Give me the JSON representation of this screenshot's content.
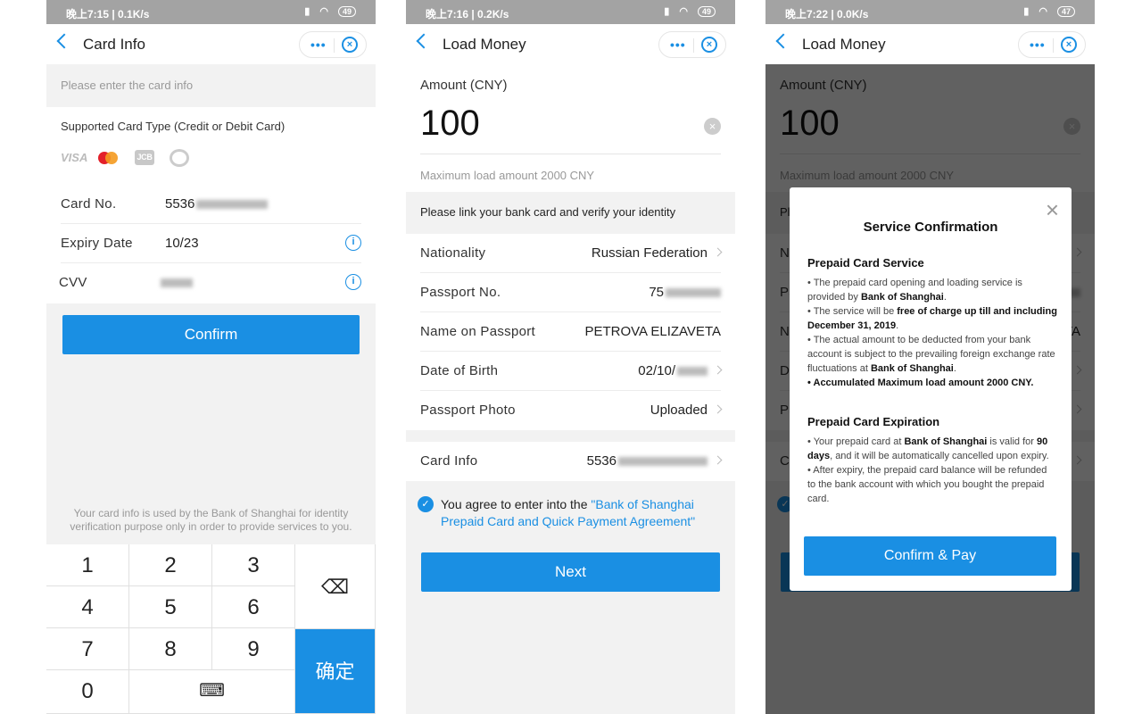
{
  "screens": [
    {
      "status": {
        "time": "晚上7:15 | 0.1K/s",
        "battery": "49"
      },
      "title": "Card Info"
    },
    {
      "status": {
        "time": "晚上7:16 | 0.2K/s",
        "battery": "49"
      },
      "title": "Load Money"
    },
    {
      "status": {
        "time": "晚上7:22 | 0.0K/s",
        "battery": "47"
      },
      "title": "Load Money"
    }
  ],
  "card_info": {
    "hint": "Please enter the card info",
    "supported_label": "Supported Card Type (Credit or Debit Card)",
    "card_brands": [
      "VISA",
      "mastercard",
      "JCB",
      "diners"
    ],
    "fields": [
      {
        "label": "Card No.",
        "value": "5536"
      },
      {
        "label": "Expiry Date",
        "value": "10/23"
      },
      {
        "label": "CVV",
        "value": ""
      }
    ],
    "confirm": "Confirm",
    "footer": "Your card info is used by the Bank of Shanghai for identity verification purpose only in order to provide services to you.",
    "keypad": {
      "keys": [
        "1",
        "2",
        "3",
        "4",
        "5",
        "6",
        "7",
        "8",
        "9",
        "0"
      ],
      "enter": "确定"
    }
  },
  "load_money": {
    "amount_label": "Amount (CNY)",
    "amount": "100",
    "max_note": "Maximum load amount 2000 CNY",
    "link_notice": "Please link your bank card and verify your identity",
    "rows": [
      {
        "label": "Nationality",
        "value": "Russian Federation"
      },
      {
        "label": "Passport No.",
        "value": "75"
      },
      {
        "label": "Name on Passport",
        "value": "PETROVA ELIZAVETA"
      },
      {
        "label": "Date of Birth",
        "value": "02/10/"
      },
      {
        "label": "Passport Photo",
        "value": "Uploaded"
      }
    ],
    "card_row": {
      "label": "Card Info",
      "value": "5536"
    },
    "agree_prefix": "You agree to enter into the ",
    "agree_link": "\"Bank of Shanghai Prepaid Card and Quick Payment Agreement\"",
    "next": "Next"
  },
  "dialog": {
    "title": "Service Confirmation",
    "section1": "Prepaid Card Service",
    "s1_items": [
      [
        {
          "t": "• The prepaid card opening and loading service is provided by "
        },
        {
          "t": "Bank of Shanghai",
          "b": 1
        },
        {
          "t": "."
        }
      ],
      [
        {
          "t": "• The service will be "
        },
        {
          "t": "free of charge up till and including December 31, 2019",
          "b": 1
        },
        {
          "t": "."
        }
      ],
      [
        {
          "t": "• The actual amount to be deducted from your bank account is subject to the prevailing foreign exchange rate fluctuations at "
        },
        {
          "t": "Bank of Shanghai",
          "b": 1
        },
        {
          "t": "."
        }
      ],
      [
        {
          "t": "• Accumulated Maximum load amount 2000 CNY.",
          "b": 1
        }
      ]
    ],
    "section2": "Prepaid Card Expiration",
    "s2_items": [
      [
        {
          "t": "• Your prepaid card at "
        },
        {
          "t": "Bank of Shanghai",
          "b": 1
        },
        {
          "t": " is valid for "
        },
        {
          "t": "90 days",
          "b": 1
        },
        {
          "t": ", and it will be automatically cancelled upon expiry."
        }
      ],
      [
        {
          "t": "• After expiry, the prepaid card balance will be refunded to the bank account with which you bought the prepaid card."
        }
      ]
    ],
    "confirm_pay": "Confirm & Pay"
  },
  "colors": {
    "accent": "#1a8fe3"
  }
}
